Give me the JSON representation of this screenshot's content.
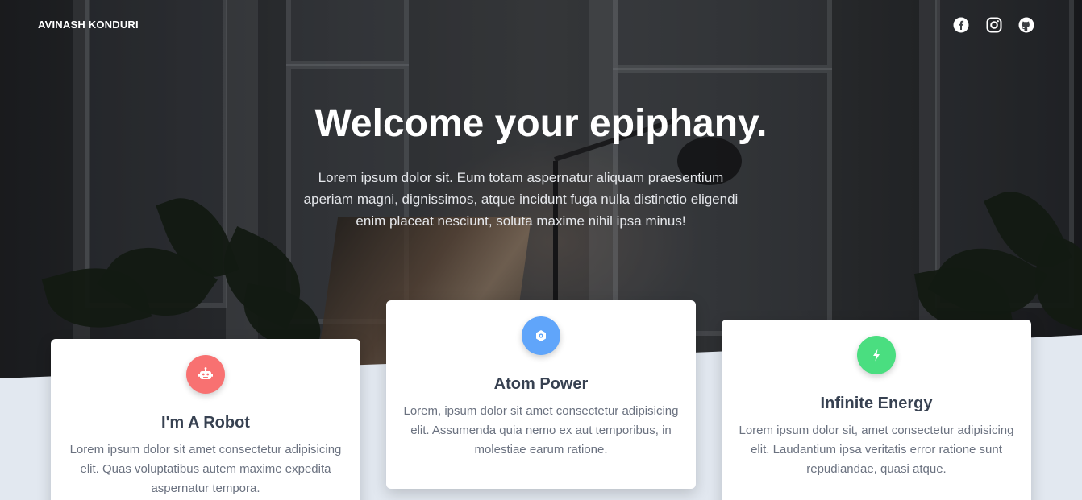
{
  "nav": {
    "brand": "AVINASH KONDURI",
    "social": [
      {
        "icon": "facebook-icon"
      },
      {
        "icon": "instagram-icon"
      },
      {
        "icon": "github-icon"
      }
    ]
  },
  "hero": {
    "title": "Welcome your epiphany.",
    "text": "Lorem ipsum dolor sit. Eum totam aspernatur aliquam praesentium aperiam magni, dignissimos, atque incidunt fuga nulla distinctio eligendi enim placeat nesciunt, soluta maxime nihil ipsa minus!"
  },
  "cards": [
    {
      "title": "I'm A Robot",
      "text": "Lorem ipsum dolor sit amet consectetur adipisicing elit. Quas voluptatibus autem maxime expedita aspernatur tempora.",
      "icon": "robot-icon",
      "color": "#f87171"
    },
    {
      "title": "Atom Power",
      "text": "Lorem, ipsum dolor sit amet consectetur adipisicing elit. Assumenda quia nemo ex aut temporibus, in molestiae earum ratione.",
      "icon": "atom-icon",
      "color": "#60a5fa"
    },
    {
      "title": "Infinite Energy",
      "text": "Lorem ipsum dolor sit, amet consectetur adipisicing elit. Laudantium ipsa veritatis error ratione sunt repudiandae, quasi atque.",
      "icon": "bolt-icon",
      "color": "#4ade80"
    }
  ],
  "colors": {
    "page_background": "#e2e8f0",
    "card_background": "#ffffff",
    "heading_text": "#374151",
    "body_text": "#6b7280"
  }
}
